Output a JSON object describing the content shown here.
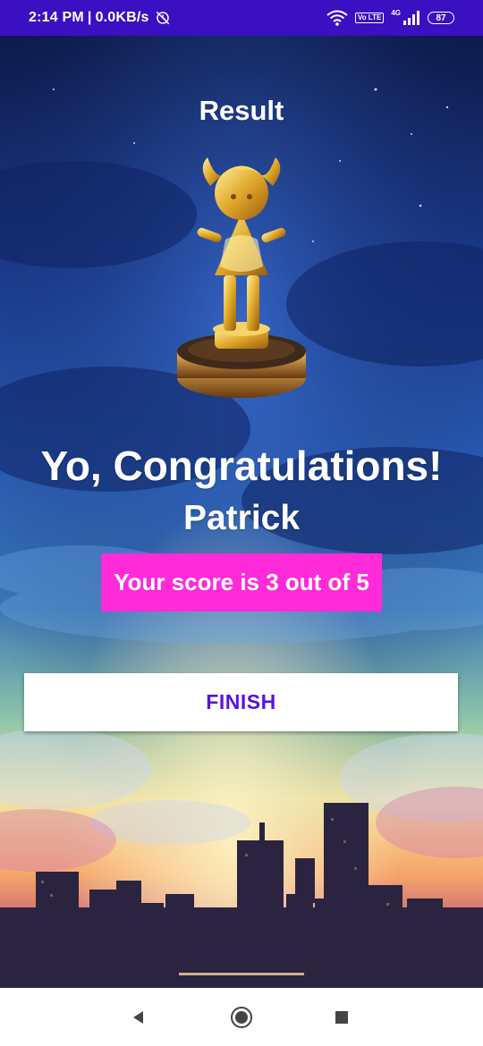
{
  "status_bar": {
    "time": "2:14 PM",
    "separator": "|",
    "network_speed": "0.0KB/s",
    "volte_label": "Vo LTE",
    "network_type": "4G",
    "battery_level": "87",
    "icons": [
      "alarm-off-icon",
      "wifi-icon",
      "volte-icon",
      "signal-icon",
      "battery-icon"
    ]
  },
  "header": {
    "title": "Result"
  },
  "trophy": {
    "icon": "trophy-figure-icon"
  },
  "result": {
    "heading": "Yo, Congratulations!",
    "player_name": "Patrick",
    "score_text": "Your score is 3 out of 5"
  },
  "actions": {
    "finish_label": "FINISH"
  },
  "nav_bar": {
    "icons": [
      "back-icon",
      "home-icon",
      "recents-icon"
    ]
  },
  "colors": {
    "status_bar_bg": "#3a10c2",
    "score_badge_bg": "#ff2bd9",
    "finish_text": "#5a12e0",
    "text_primary": "#ffffff",
    "nav_bar_bg": "#ffffff",
    "nav_icon": "#444444"
  }
}
